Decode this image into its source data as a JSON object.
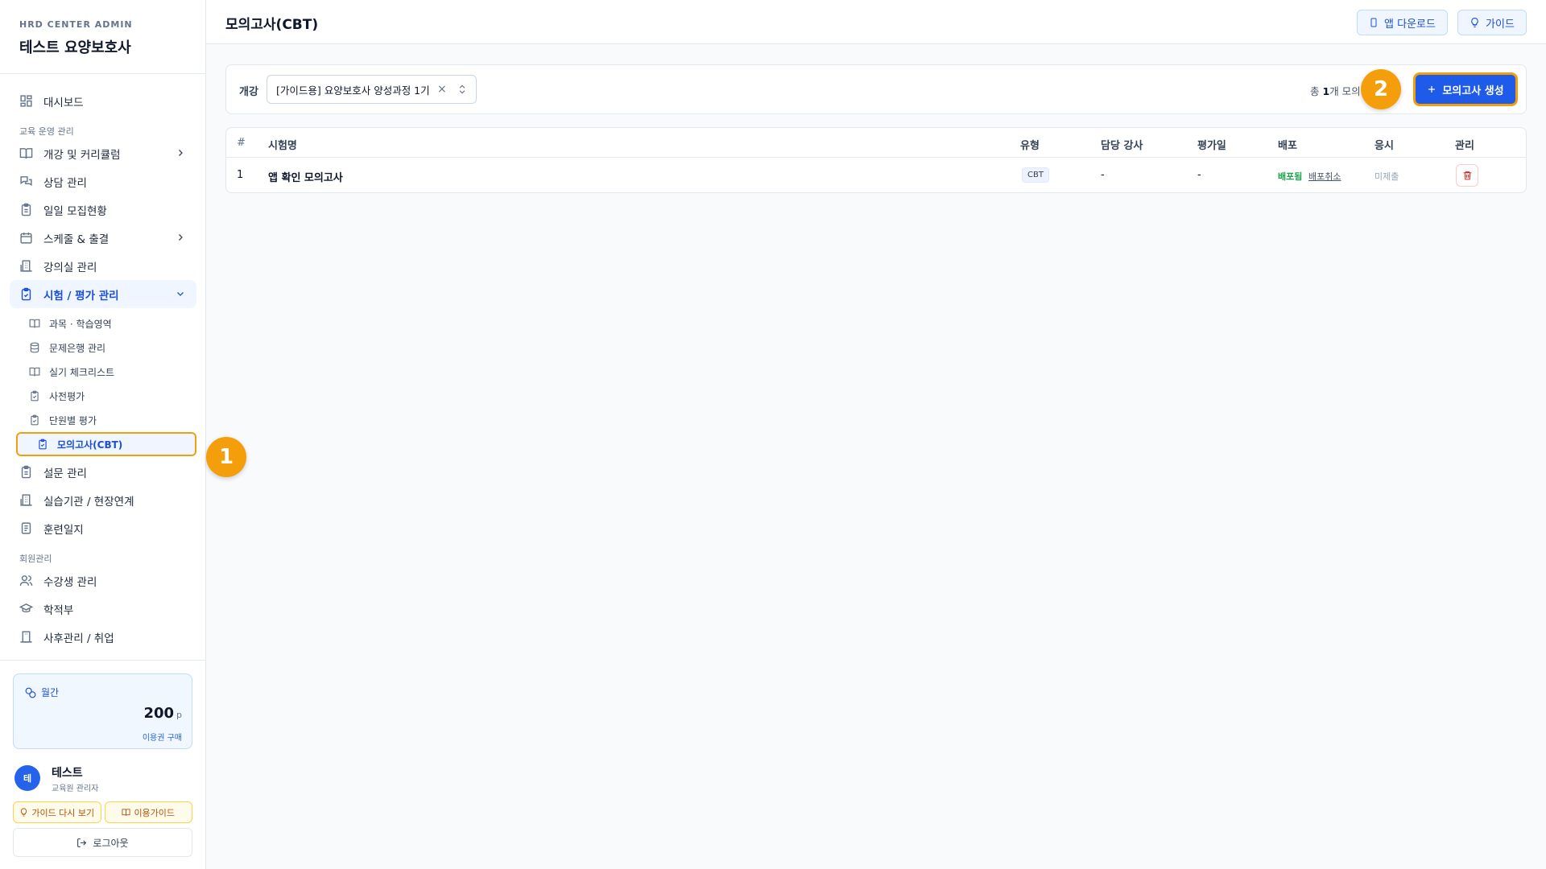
{
  "brand": {
    "subtitle": "HRD CENTER ADMIN",
    "title": "테스트 요양보호사"
  },
  "nav": {
    "dashboard": "대시보드",
    "section_edu": "교육 운영 관리",
    "courses": "개강 및 커리큘럼",
    "consult": "상담 관리",
    "daily_recruit": "일일 모집현황",
    "schedule": "스케줄 & 출결",
    "classroom": "강의실 관리",
    "exam": "시험 / 평가 관리",
    "sub": {
      "subjects": "과목 · 학습영역",
      "question_bank": "문제은행 관리",
      "practical_checklist": "실기 체크리스트",
      "pre_eval": "사전평가",
      "unit_eval": "단원별 평가",
      "mock_exam": "모의고사(CBT)"
    },
    "survey": "설문 관리",
    "practice_org": "실습기관 / 현장연계",
    "training_log": "훈련일지",
    "section_member": "회원관리",
    "students": "수강생 관리",
    "academic_records": "학적부",
    "aftercare": "사후관리 / 취업"
  },
  "points": {
    "label": "월간",
    "value": "200",
    "unit": "p",
    "buy": "이용권 구매"
  },
  "user": {
    "avatar": "테",
    "name": "테스트",
    "role": "교육원 관리자"
  },
  "bottom": {
    "guide_again": "가이드 다시 보기",
    "usage_guide": "이용가이드",
    "logout": "로그아웃"
  },
  "header": {
    "title": "모의고사(CBT)",
    "app_download": "앱 다운로드",
    "guide": "가이드"
  },
  "filter": {
    "label": "개강",
    "selected": "[가이드용] 요양보호사 양성과정 1기",
    "total_prefix": "총 ",
    "total_count": "1",
    "total_suffix": "개 모의",
    "create_button": "모의고사 생성"
  },
  "table": {
    "columns": [
      "#",
      "시험명",
      "유형",
      "담당 강사",
      "평가일",
      "배포",
      "응시",
      "관리"
    ],
    "rows": [
      {
        "no": "1",
        "name": "앱 확인 모의고사",
        "type": "CBT",
        "instructor": "-",
        "date": "-",
        "deploy_status": "배포됨",
        "deploy_cancel": "배포취소",
        "submission": "미제출"
      }
    ]
  },
  "callouts": [
    "1",
    "2"
  ],
  "colors": {
    "accent": "#1d5be8",
    "highlight": "#f59e0b",
    "success": "#16a34a",
    "danger": "#dc2626"
  }
}
